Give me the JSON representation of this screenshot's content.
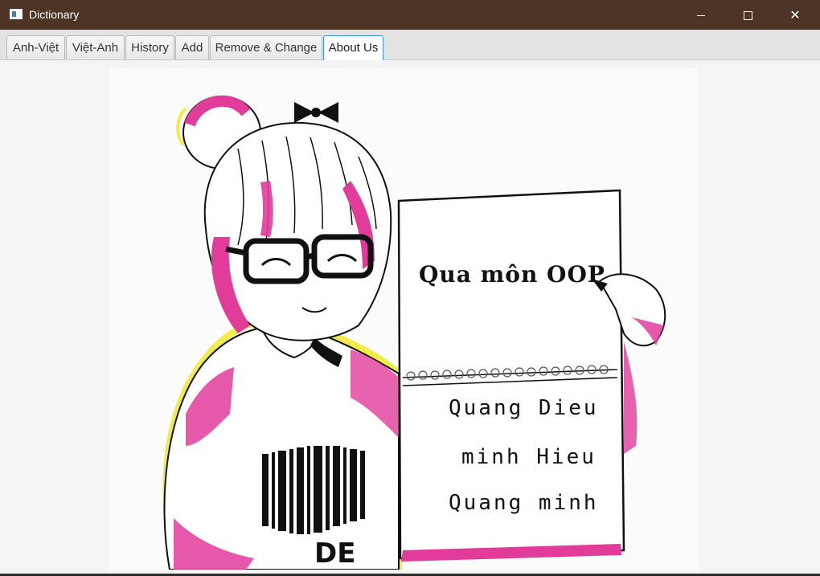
{
  "window": {
    "title": "Dictionary",
    "title_bar_color": "#4e3424",
    "controls": {
      "minimize_icon": "minimize-icon",
      "maximize_icon": "maximize-icon",
      "close_icon": "close-icon"
    }
  },
  "tabs": [
    {
      "label": "Anh-Việt",
      "active": false
    },
    {
      "label": "Việt-Anh",
      "active": false
    },
    {
      "label": "History",
      "active": false
    },
    {
      "label": "Add",
      "active": false
    },
    {
      "label": "Remove & Change",
      "active": false
    },
    {
      "label": "About Us",
      "active": true
    }
  ],
  "about": {
    "sign_title": "Qua môn OOP",
    "authors": [
      "Quang Dieu",
      "minh Hieu",
      "Quang minh"
    ],
    "accent_colors": {
      "pink": "#e23c9b",
      "yellow": "#f2ec4a",
      "line": "#111111"
    }
  }
}
